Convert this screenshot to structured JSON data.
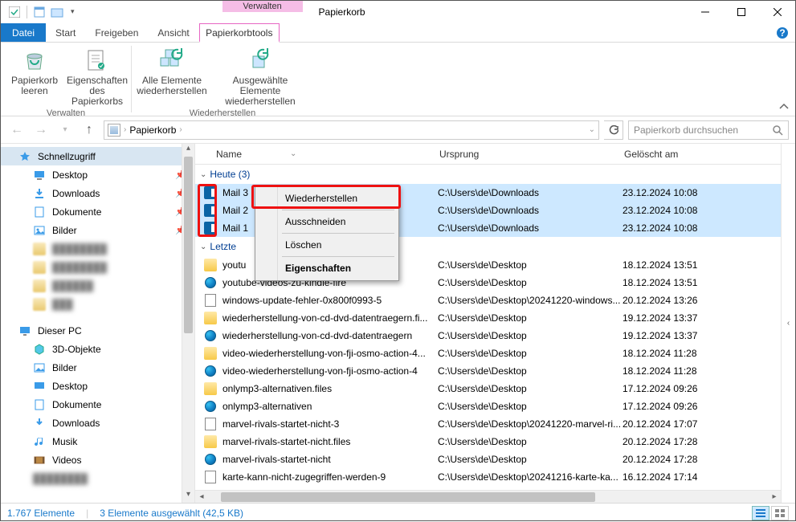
{
  "window": {
    "title": "Papierkorb",
    "context_tab_header": "Verwalten",
    "menus": {
      "file": "Datei",
      "start": "Start",
      "share": "Freigeben",
      "view": "Ansicht",
      "recyclebin_tools": "Papierkorbtools"
    }
  },
  "ribbon": {
    "manage_group": "Verwalten",
    "restore_group": "Wiederherstellen",
    "empty_bin": "Papierkorb\nleeren",
    "bin_properties": "Eigenschaften\ndes Papierkorbs",
    "restore_all": "Alle Elemente\nwiederherstellen",
    "restore_selected": "Ausgewählte Elemente\nwiederherstellen"
  },
  "nav": {
    "location": "Papierkorb",
    "search_placeholder": "Papierkorb durchsuchen"
  },
  "sidebar": {
    "quick_access": "Schnellzugriff",
    "desktop": "Desktop",
    "downloads": "Downloads",
    "documents": "Dokumente",
    "pictures": "Bilder",
    "this_pc": "Dieser PC",
    "objects3d": "3D-Objekte",
    "pc_pictures": "Bilder",
    "pc_desktop": "Desktop",
    "pc_documents": "Dokumente",
    "pc_downloads": "Downloads",
    "music": "Musik",
    "videos": "Videos"
  },
  "columns": {
    "name": "Name",
    "origin": "Ursprung",
    "deleted": "Gelöscht am"
  },
  "groups": {
    "today": "Heute (3)",
    "last_week_prefix": "Letzte "
  },
  "selected_rows": [
    {
      "name": "Mail 3",
      "origin": "C:\\Users\\de\\Downloads",
      "deleted": "23.12.2024 10:08"
    },
    {
      "name": "Mail 2",
      "origin": "C:\\Users\\de\\Downloads",
      "deleted": "23.12.2024 10:08"
    },
    {
      "name": "Mail 1",
      "origin": "C:\\Users\\de\\Downloads",
      "deleted": "23.12.2024 10:08"
    }
  ],
  "rows": [
    {
      "icon": "folder",
      "name": "youtu",
      "origin": "C:\\Users\\de\\Desktop",
      "deleted": "18.12.2024 13:51"
    },
    {
      "icon": "edge",
      "name": "youtube-videos-zu-kindle-fire",
      "origin": "C:\\Users\\de\\Desktop",
      "deleted": "18.12.2024 13:51"
    },
    {
      "icon": "doc",
      "name": "windows-update-fehler-0x800f0993-5",
      "origin": "C:\\Users\\de\\Desktop\\20241220-windows...",
      "deleted": "20.12.2024 13:26"
    },
    {
      "icon": "folder",
      "name": "wiederherstellung-von-cd-dvd-datentraegern.fi...",
      "origin": "C:\\Users\\de\\Desktop",
      "deleted": "19.12.2024 13:37"
    },
    {
      "icon": "edge",
      "name": "wiederherstellung-von-cd-dvd-datentraegern",
      "origin": "C:\\Users\\de\\Desktop",
      "deleted": "19.12.2024 13:37"
    },
    {
      "icon": "folder",
      "name": "video-wiederherstellung-von-fji-osmo-action-4...",
      "origin": "C:\\Users\\de\\Desktop",
      "deleted": "18.12.2024 11:28"
    },
    {
      "icon": "edge",
      "name": "video-wiederherstellung-von-fji-osmo-action-4",
      "origin": "C:\\Users\\de\\Desktop",
      "deleted": "18.12.2024 11:28"
    },
    {
      "icon": "folder",
      "name": "onlymp3-alternativen.files",
      "origin": "C:\\Users\\de\\Desktop",
      "deleted": "17.12.2024 09:26"
    },
    {
      "icon": "edge",
      "name": "onlymp3-alternativen",
      "origin": "C:\\Users\\de\\Desktop",
      "deleted": "17.12.2024 09:26"
    },
    {
      "icon": "doc",
      "name": "marvel-rivals-startet-nicht-3",
      "origin": "C:\\Users\\de\\Desktop\\20241220-marvel-ri...",
      "deleted": "20.12.2024 17:07"
    },
    {
      "icon": "folder",
      "name": "marvel-rivals-startet-nicht.files",
      "origin": "C:\\Users\\de\\Desktop",
      "deleted": "20.12.2024 17:28"
    },
    {
      "icon": "edge",
      "name": "marvel-rivals-startet-nicht",
      "origin": "C:\\Users\\de\\Desktop",
      "deleted": "20.12.2024 17:28"
    },
    {
      "icon": "doc",
      "name": "karte-kann-nicht-zugegriffen-werden-9",
      "origin": "C:\\Users\\de\\Desktop\\20241216-karte-ka...",
      "deleted": "16.12.2024 17:14"
    }
  ],
  "context_menu": {
    "restore": "Wiederherstellen",
    "cut": "Ausschneiden",
    "delete": "Löschen",
    "properties": "Eigenschaften"
  },
  "status": {
    "item_count": "1.767 Elemente",
    "selection": "3 Elemente ausgewählt (42,5 KB)"
  }
}
